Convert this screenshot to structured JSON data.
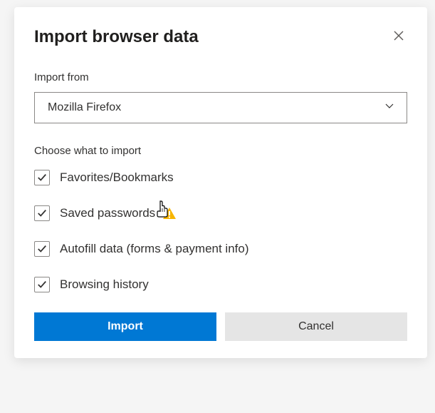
{
  "dialog": {
    "title": "Import browser data",
    "importFromLabel": "Import from",
    "select": {
      "value": "Mozilla Firefox"
    },
    "chooseLabel": "Choose what to import",
    "options": [
      {
        "label": "Favorites/Bookmarks",
        "checked": true,
        "warning": false
      },
      {
        "label": "Saved passwords",
        "checked": true,
        "warning": true
      },
      {
        "label": "Autofill data (forms & payment info)",
        "checked": true,
        "warning": false
      },
      {
        "label": "Browsing history",
        "checked": true,
        "warning": false
      }
    ],
    "buttons": {
      "primary": "Import",
      "secondary": "Cancel"
    }
  }
}
